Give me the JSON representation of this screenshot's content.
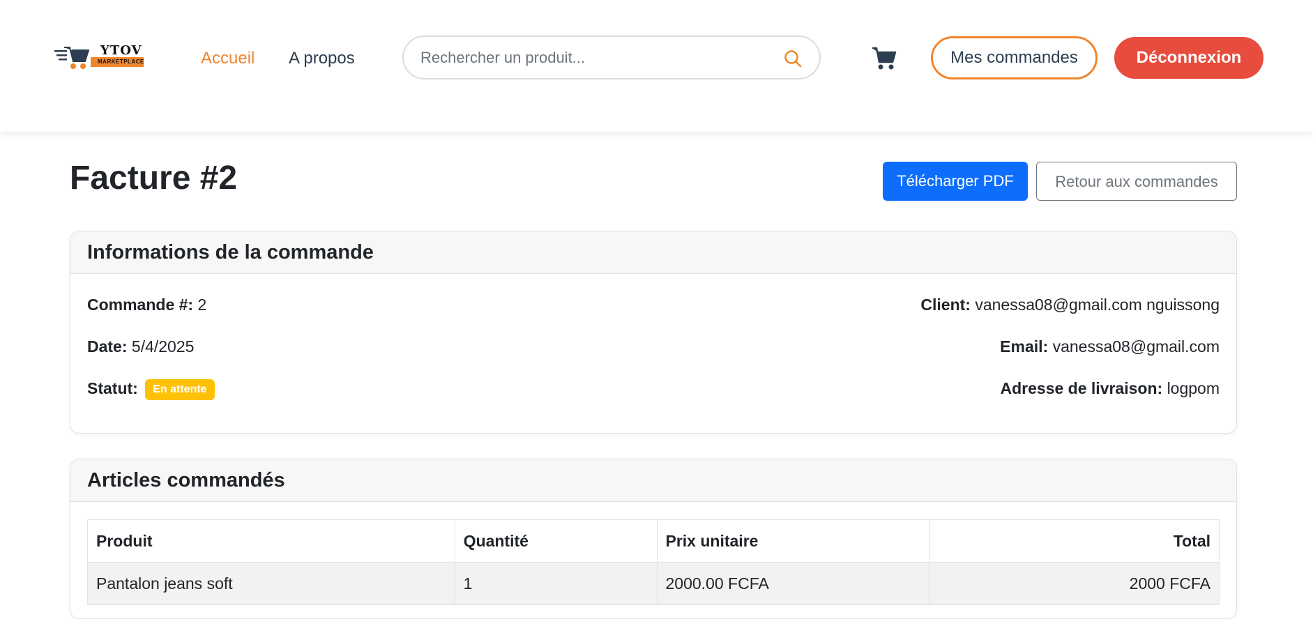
{
  "header": {
    "logo": {
      "brand": "YTOV",
      "tagline": "MARKETPLACE"
    },
    "nav": [
      {
        "label": "Accueil",
        "active": true
      },
      {
        "label": "A propos",
        "active": false
      }
    ],
    "search": {
      "placeholder": "Rechercher un produit...",
      "value": ""
    },
    "cart_icon": "cart-icon",
    "orders_button": "Mes commandes",
    "logout_button": "Déconnexion"
  },
  "page": {
    "title": "Facture #2",
    "download_button": "Télécharger PDF",
    "back_button": "Retour aux commandes"
  },
  "order_info": {
    "header": "Informations de la commande",
    "order_label": "Commande #:",
    "order_value": "2",
    "date_label": "Date:",
    "date_value": "5/4/2025",
    "status_label": "Statut:",
    "status_value": "En attente",
    "client_label": "Client:",
    "client_value": "vanessa08@gmail.com nguissong",
    "email_label": "Email:",
    "email_value": "vanessa08@gmail.com",
    "address_label": "Adresse de livraison:",
    "address_value": "logpom"
  },
  "items": {
    "header": "Articles commandés",
    "columns": [
      "Produit",
      "Quantité",
      "Prix unitaire",
      "Total"
    ],
    "rows": [
      [
        "Pantalon jeans soft",
        "1",
        "2000.00 FCFA",
        "2000 FCFA"
      ]
    ]
  },
  "colors": {
    "accent_orange": "#f0852d",
    "logout_red": "#e74c3c",
    "primary_blue": "#0d6efd",
    "badge_yellow": "#ffc107",
    "nav_dark": "#2c3e50"
  }
}
